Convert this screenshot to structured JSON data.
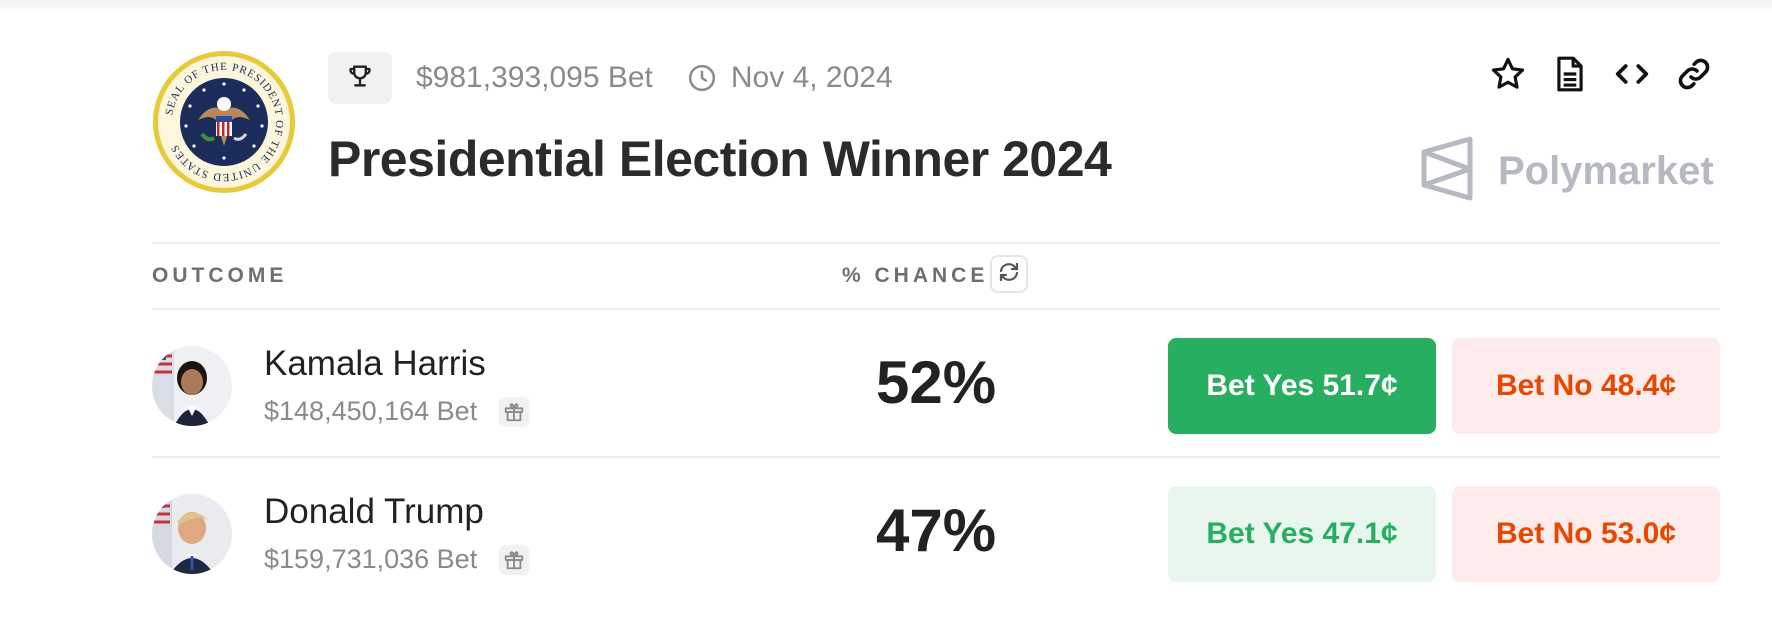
{
  "market": {
    "volume": "$981,393,095 Bet",
    "date": "Nov 4, 2024",
    "title": "Presidential Election Winner 2024",
    "brand": "Polymarket",
    "seal_text": "SEAL OF THE PRESIDENT OF THE UNITED STATES"
  },
  "table": {
    "col_outcome": "OUTCOME",
    "col_chance": "% CHANCE"
  },
  "candidates": [
    {
      "name": "Kamala Harris",
      "volume": "$148,450,164 Bet",
      "chance": "52%",
      "yes_label": "Bet Yes 51.7¢",
      "no_label": "Bet No 48.4¢"
    },
    {
      "name": "Donald Trump",
      "volume": "$159,731,036 Bet",
      "chance": "47%",
      "yes_label": "Bet Yes 47.1¢",
      "no_label": "Bet No 53.0¢"
    }
  ],
  "colors": {
    "yes_green": "#27ae60",
    "no_orange": "#e64800",
    "seal_gold": "#e8c93a",
    "seal_navy": "#1c2c5b"
  },
  "icons": {
    "trophy": "trophy-icon",
    "clock": "clock-icon",
    "star": "star-icon",
    "document": "document-icon",
    "embed": "code-icon",
    "link": "link-icon",
    "refresh": "refresh-icon",
    "gift": "gift-icon"
  }
}
